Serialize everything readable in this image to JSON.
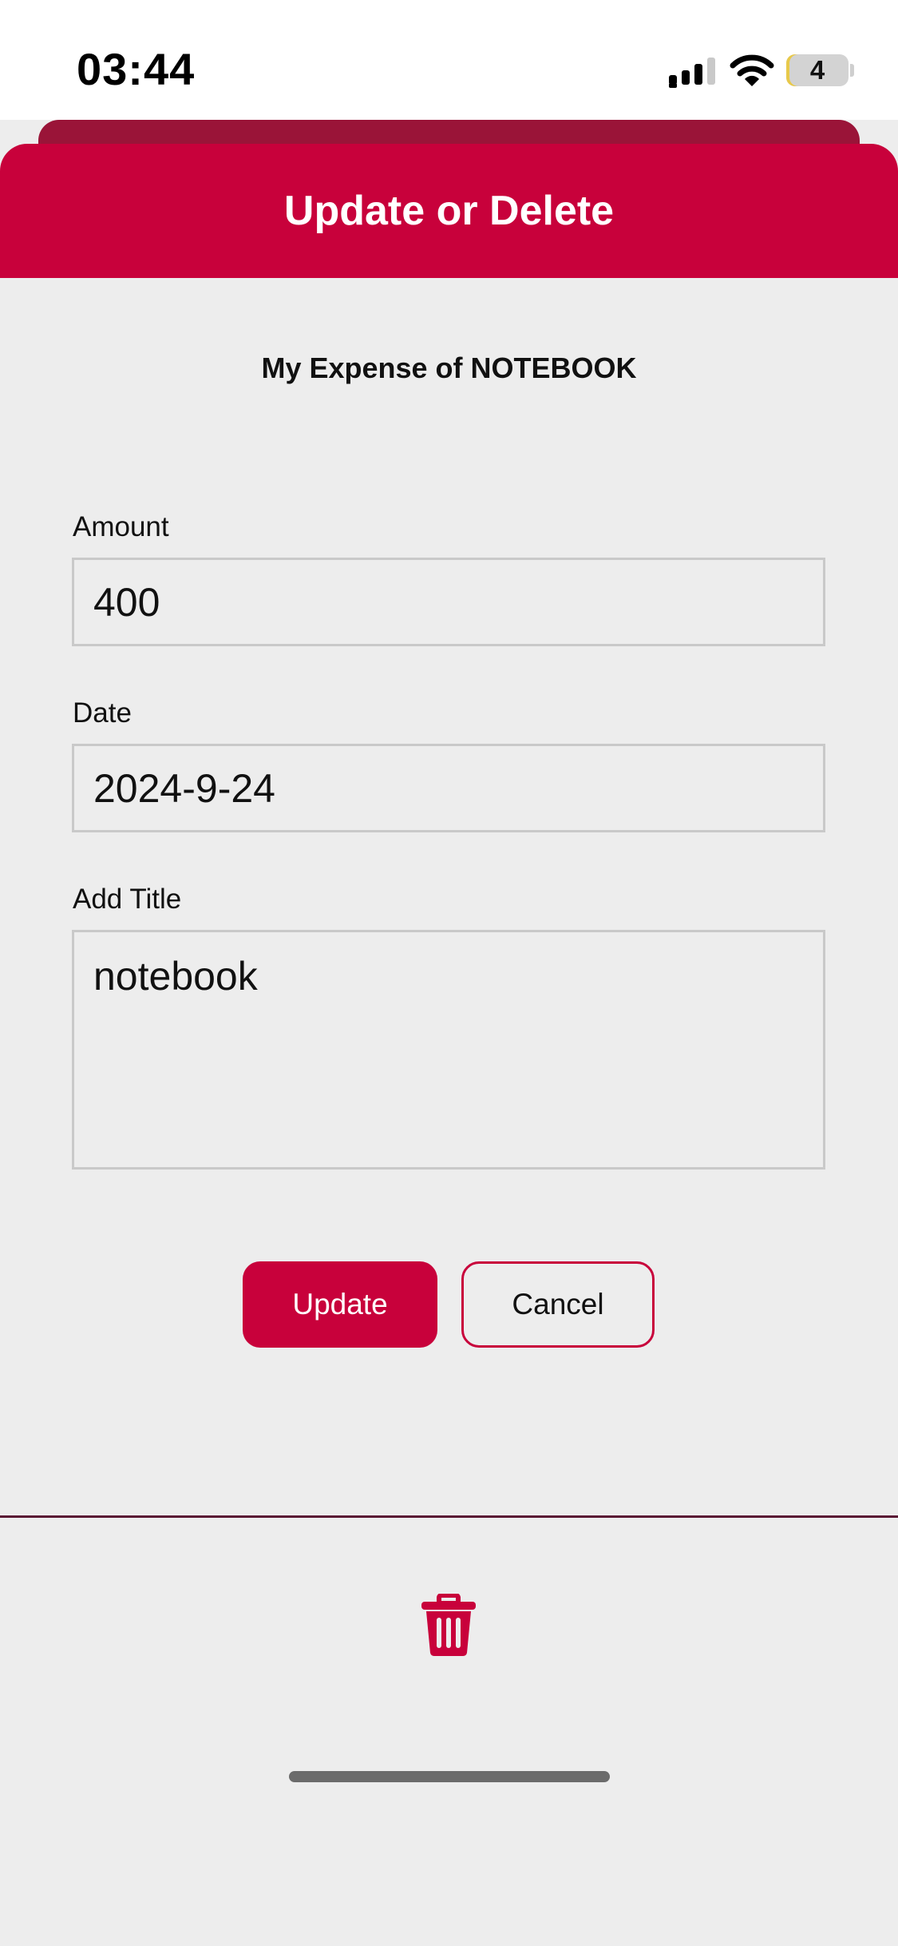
{
  "status_bar": {
    "time": "03:44",
    "battery_level": "4",
    "icons": [
      "cellular-signal-icon",
      "wifi-icon",
      "battery-icon"
    ]
  },
  "header": {
    "title": "Update or Delete"
  },
  "content": {
    "subtitle": "My Expense of NOTEBOOK",
    "amount": {
      "label": "Amount",
      "value": "400"
    },
    "date": {
      "label": "Date",
      "value": "2024-9-24"
    },
    "title_field": {
      "label": "Add Title",
      "value": "notebook"
    }
  },
  "actions": {
    "update_label": "Update",
    "cancel_label": "Cancel",
    "delete_icon": "trash-icon"
  },
  "colors": {
    "accent": "#c8013b",
    "sheet_back": "#9a1438",
    "background": "#ededed",
    "divider": "#5a1734"
  }
}
